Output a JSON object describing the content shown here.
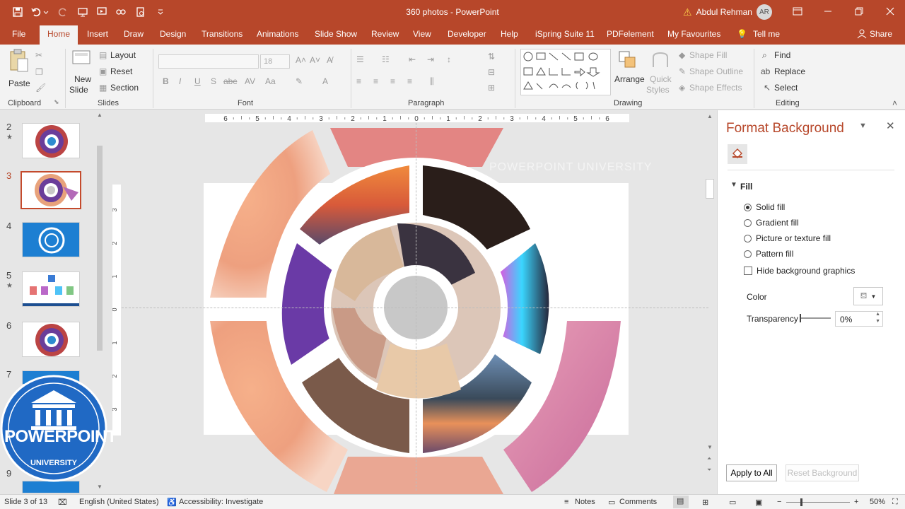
{
  "app": {
    "document_title": "360 photos - PowerPoint",
    "user_name": "Abdul Rehman",
    "user_initials": "AR",
    "accent_color": "#b7472a"
  },
  "tabs": [
    {
      "label": "File"
    },
    {
      "label": "Home"
    },
    {
      "label": "Insert"
    },
    {
      "label": "Draw"
    },
    {
      "label": "Design"
    },
    {
      "label": "Transitions"
    },
    {
      "label": "Animations"
    },
    {
      "label": "Slide Show"
    },
    {
      "label": "Review"
    },
    {
      "label": "View"
    },
    {
      "label": "Developer"
    },
    {
      "label": "Help"
    },
    {
      "label": "iSpring Suite 11"
    },
    {
      "label": "PDFelement"
    },
    {
      "label": "My Favourites"
    },
    {
      "label": "Tell me"
    }
  ],
  "share_label": "Share",
  "ribbon": {
    "clipboard": {
      "group": "Clipboard",
      "paste": "Paste"
    },
    "slides": {
      "group": "Slides",
      "new_slide_1": "New",
      "new_slide_2": "Slide",
      "layout": "Layout",
      "reset": "Reset",
      "section": "Section"
    },
    "font": {
      "group": "Font",
      "size": "18"
    },
    "paragraph": {
      "group": "Paragraph"
    },
    "drawing": {
      "group": "Drawing",
      "arrange": "Arrange",
      "quick_styles_1": "Quick",
      "quick_styles_2": "Styles",
      "shape_fill": "Shape Fill",
      "shape_outline": "Shape Outline",
      "shape_effects": "Shape Effects"
    },
    "editing": {
      "group": "Editing",
      "find": "Find",
      "replace": "Replace",
      "select": "Select"
    }
  },
  "thumbnails": [
    {
      "num": "2",
      "star": "★",
      "selected": false
    },
    {
      "num": "3",
      "star": "",
      "selected": true
    },
    {
      "num": "4",
      "star": "",
      "selected": false
    },
    {
      "num": "5",
      "star": "★",
      "selected": false
    },
    {
      "num": "6",
      "star": "",
      "selected": false
    },
    {
      "num": "7",
      "star": "",
      "selected": false
    },
    {
      "num": "9",
      "star": "",
      "selected": false
    }
  ],
  "ruler": {
    "h_ticks": [
      "6",
      "5",
      "4",
      "3",
      "2",
      "1",
      "0",
      "1",
      "2",
      "3",
      "4",
      "5",
      "6"
    ],
    "v_ticks": [
      "3",
      "2",
      "1",
      "0",
      "1",
      "2",
      "3"
    ]
  },
  "logo": {
    "text_main": "POWERPOINT",
    "text_sub": "UNIVERSITY",
    "watermark": "POWERPOINT UNIVERSITY"
  },
  "format_pane": {
    "title": "Format Background",
    "section": "Fill",
    "options": [
      {
        "label": "Solid fill",
        "selected": true
      },
      {
        "label": "Gradient fill",
        "selected": false
      },
      {
        "label": "Picture or texture fill",
        "selected": false
      },
      {
        "label": "Pattern fill",
        "selected": false
      }
    ],
    "hide_graphics": "Hide background graphics",
    "color_label": "Color",
    "transparency_label": "Transparency",
    "transparency_value": "0%",
    "apply_all": "Apply to All",
    "reset_background": "Reset Background"
  },
  "status": {
    "slide_info": "Slide 3 of 13",
    "language": "English (United States)",
    "accessibility": "Accessibility: Investigate",
    "notes": "Notes",
    "comments": "Comments",
    "zoom": "50%"
  }
}
